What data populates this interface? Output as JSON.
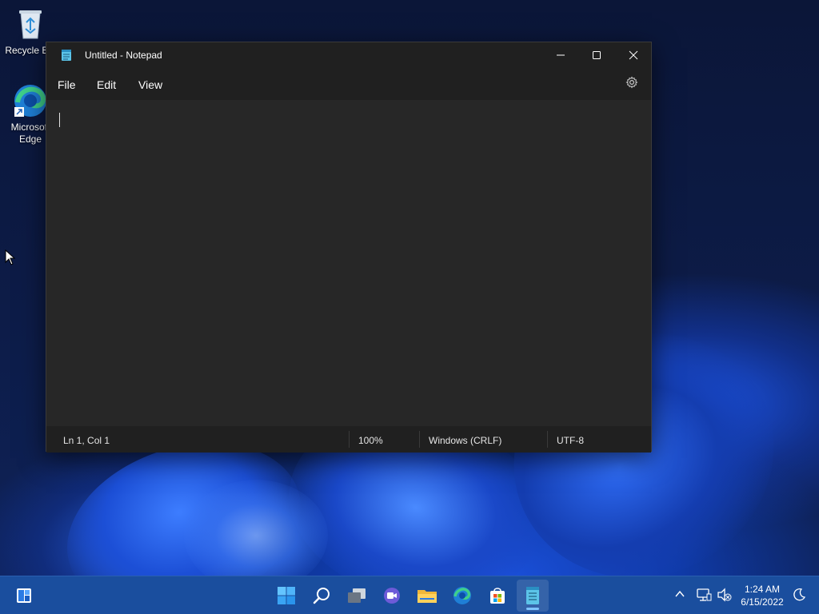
{
  "desktop": {
    "icons": [
      {
        "label": "Recycle Bin",
        "icon": "recycle-bin-icon"
      },
      {
        "label": "Microsoft Edge",
        "icon": "edge-icon"
      }
    ]
  },
  "window": {
    "title": "Untitled - Notepad",
    "app_icon": "notepad-icon",
    "controls": {
      "minimize": "minimize-icon",
      "maximize": "maximize-icon",
      "close": "close-icon"
    },
    "menu": [
      {
        "label": "File"
      },
      {
        "label": "Edit"
      },
      {
        "label": "View"
      }
    ],
    "settings_icon": "gear-icon",
    "editor": {
      "content": ""
    },
    "status": {
      "position": "Ln 1, Col 1",
      "zoom": "100%",
      "line_ending": "Windows (CRLF)",
      "encoding": "UTF-8"
    }
  },
  "taskbar": {
    "apps": [
      {
        "name": "widgets",
        "icon": "widgets-icon"
      },
      {
        "name": "start",
        "icon": "windows-start-icon"
      },
      {
        "name": "search",
        "icon": "search-icon"
      },
      {
        "name": "task-view",
        "icon": "task-view-icon"
      },
      {
        "name": "chat",
        "icon": "chat-icon"
      },
      {
        "name": "file-explorer",
        "icon": "folder-icon"
      },
      {
        "name": "edge",
        "icon": "edge-icon"
      },
      {
        "name": "store",
        "icon": "store-icon"
      },
      {
        "name": "notepad",
        "icon": "notepad-icon",
        "active": true
      }
    ],
    "tray": {
      "time": "1:24 AM",
      "date": "6/15/2022"
    }
  },
  "colors": {
    "window_bg": "#202020",
    "editor_bg": "#272727",
    "taskbar_bg": "#1a4e9e",
    "accent": "#7ec4ff"
  }
}
